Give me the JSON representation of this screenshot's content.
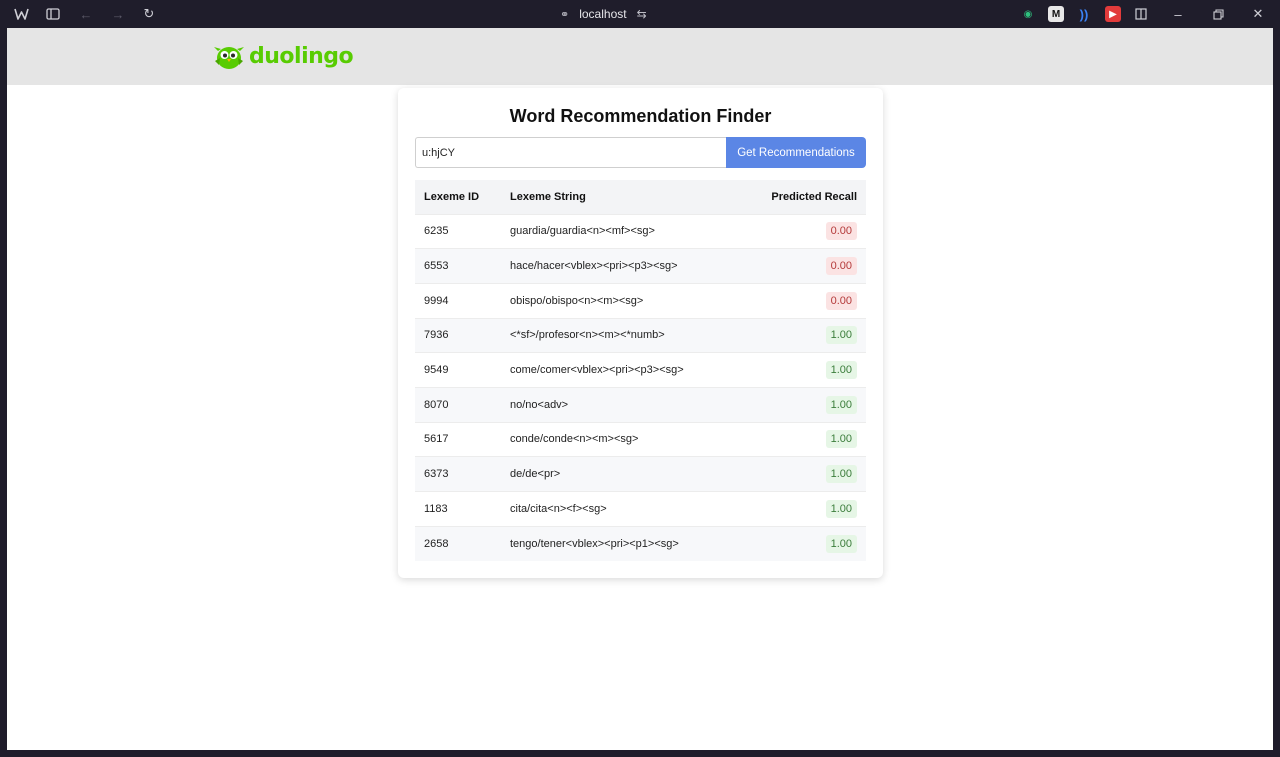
{
  "browser": {
    "url": "localhost"
  },
  "app": {
    "brand": "duolingo",
    "title": "Word Recommendation Finder",
    "search": {
      "value": "u:hjCY",
      "placeholder": ""
    },
    "button_label": "Get Recommendations"
  },
  "table": {
    "headers": [
      "Lexeme ID",
      "Lexeme String",
      "Predicted Recall"
    ],
    "rows": [
      {
        "id": "6235",
        "lexeme": "guardia/guardia<n><mf><sg>",
        "recall": "0.00",
        "level": "low"
      },
      {
        "id": "6553",
        "lexeme": "hace/hacer<vblex><pri><p3><sg>",
        "recall": "0.00",
        "level": "low"
      },
      {
        "id": "9994",
        "lexeme": "obispo/obispo<n><m><sg>",
        "recall": "0.00",
        "level": "low"
      },
      {
        "id": "7936",
        "lexeme": "<*sf>/profesor<n><m><*numb>",
        "recall": "1.00",
        "level": "high"
      },
      {
        "id": "9549",
        "lexeme": "come/comer<vblex><pri><p3><sg>",
        "recall": "1.00",
        "level": "high"
      },
      {
        "id": "8070",
        "lexeme": "no/no<adv>",
        "recall": "1.00",
        "level": "high"
      },
      {
        "id": "5617",
        "lexeme": "conde/conde<n><m><sg>",
        "recall": "1.00",
        "level": "high"
      },
      {
        "id": "6373",
        "lexeme": "de/de<pr>",
        "recall": "1.00",
        "level": "high"
      },
      {
        "id": "1183",
        "lexeme": "cita/cita<n><f><sg>",
        "recall": "1.00",
        "level": "high"
      },
      {
        "id": "2658",
        "lexeme": "tengo/tener<vblex><pri><p1><sg>",
        "recall": "1.00",
        "level": "high"
      }
    ]
  },
  "colors": {
    "brand_green": "#58cc02",
    "button_blue": "#5b86e5",
    "low_bg": "#fbe3e3",
    "high_bg": "#e6f6e6"
  }
}
